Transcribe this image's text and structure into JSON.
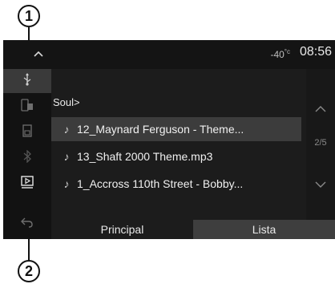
{
  "callouts": {
    "top": "1",
    "bottom": "2"
  },
  "status": {
    "temperature": "-40",
    "temperature_unit": "°c",
    "time": "08:56"
  },
  "breadcrumb": "Soul>",
  "tracks": [
    {
      "title": "12_Maynard Ferguson - Theme...",
      "selected": true
    },
    {
      "title": "13_Shaft 2000 Theme.mp3",
      "selected": false
    },
    {
      "title": "1_Accross 110th Street - Bobby...",
      "selected": false
    }
  ],
  "pagination": "2/5",
  "tabs": {
    "principal": "Principal",
    "lista": "Lista",
    "active": "lista"
  },
  "sidebar": {
    "items": [
      {
        "icon": "usb-icon",
        "active": true
      },
      {
        "icon": "phone-media-icon",
        "active": false
      },
      {
        "icon": "sd-card-icon",
        "active": false
      },
      {
        "icon": "bluetooth-icon",
        "active": false
      },
      {
        "icon": "media-player-icon",
        "active": false
      },
      {
        "icon": "back-icon",
        "active": false
      }
    ]
  },
  "colors": {
    "screen_bg": "#1c1c1c",
    "selected_row": "#3c3c3c",
    "active_tab": "#3e3e3e"
  }
}
